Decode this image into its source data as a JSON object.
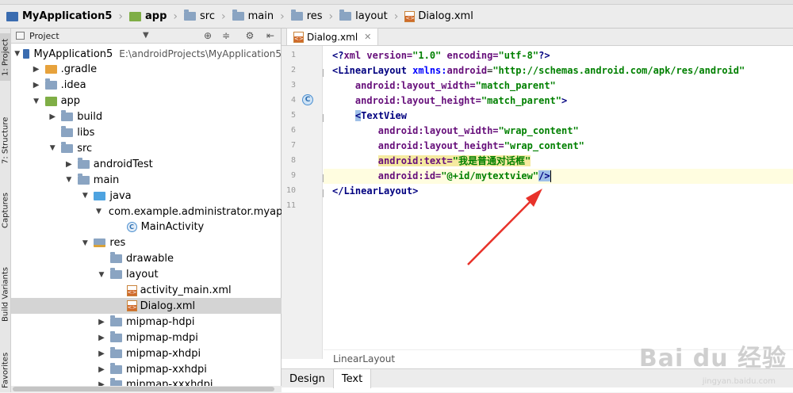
{
  "breadcrumb": [
    {
      "label": "MyApplication5",
      "icon": "project-icon"
    },
    {
      "label": "app",
      "icon": "module-icon"
    },
    {
      "label": "src",
      "icon": "folder-icon"
    },
    {
      "label": "main",
      "icon": "folder-icon"
    },
    {
      "label": "res",
      "icon": "folder-icon"
    },
    {
      "label": "layout",
      "icon": "folder-icon"
    },
    {
      "label": "Dialog.xml",
      "icon": "xml-file-icon"
    }
  ],
  "side_tabs": [
    "1: Project",
    "7: Structure",
    "Captures",
    "Build Variants",
    "Favorites"
  ],
  "project_panel": {
    "title": "Project",
    "tree": [
      {
        "label": "MyApplication5",
        "path": "E:\\androidProjects\\MyApplication5",
        "depth": 0,
        "arrow": "open",
        "icon": "project"
      },
      {
        "label": ".gradle",
        "depth": 1,
        "arrow": "closed",
        "icon": "gradle"
      },
      {
        "label": ".idea",
        "depth": 1,
        "arrow": "closed",
        "icon": "folder"
      },
      {
        "label": "app",
        "depth": 1,
        "arrow": "open",
        "icon": "module"
      },
      {
        "label": "build",
        "depth": 2,
        "arrow": "closed",
        "icon": "folder"
      },
      {
        "label": "libs",
        "depth": 2,
        "arrow": "none",
        "icon": "folder"
      },
      {
        "label": "src",
        "depth": 2,
        "arrow": "open",
        "icon": "folder"
      },
      {
        "label": "androidTest",
        "depth": 3,
        "arrow": "closed",
        "icon": "folder"
      },
      {
        "label": "main",
        "depth": 3,
        "arrow": "open",
        "icon": "folder"
      },
      {
        "label": "java",
        "depth": 4,
        "arrow": "open",
        "icon": "java"
      },
      {
        "label": "com.example.administrator.myappl",
        "depth": 5,
        "arrow": "open",
        "icon": "package"
      },
      {
        "label": "MainActivity",
        "depth": 6,
        "arrow": "none",
        "icon": "class"
      },
      {
        "label": "res",
        "depth": 4,
        "arrow": "open",
        "icon": "res"
      },
      {
        "label": "drawable",
        "depth": 5,
        "arrow": "none",
        "icon": "folder"
      },
      {
        "label": "layout",
        "depth": 5,
        "arrow": "open",
        "icon": "folder"
      },
      {
        "label": "activity_main.xml",
        "depth": 6,
        "arrow": "none",
        "icon": "xml"
      },
      {
        "label": "Dialog.xml",
        "depth": 6,
        "arrow": "none",
        "icon": "xml",
        "selected": true
      },
      {
        "label": "mipmap-hdpi",
        "depth": 5,
        "arrow": "closed",
        "icon": "folder"
      },
      {
        "label": "mipmap-mdpi",
        "depth": 5,
        "arrow": "closed",
        "icon": "folder"
      },
      {
        "label": "mipmap-xhdpi",
        "depth": 5,
        "arrow": "closed",
        "icon": "folder"
      },
      {
        "label": "mipmap-xxhdpi",
        "depth": 5,
        "arrow": "closed",
        "icon": "folder"
      },
      {
        "label": "mipmap-xxxhdpi",
        "depth": 5,
        "arrow": "closed",
        "icon": "folder"
      }
    ]
  },
  "editor": {
    "tab_label": "Dialog.xml",
    "line_numbers": [
      "1",
      "2",
      "3",
      "4",
      "5",
      "6",
      "7",
      "8",
      "9",
      "10",
      "11"
    ],
    "lines": [
      [
        {
          "t": "<?",
          "c": "t-tag"
        },
        {
          "t": "xml ",
          "c": "t-attr"
        },
        {
          "t": "version=",
          "c": "t-attr"
        },
        {
          "t": "\"1.0\"",
          "c": "t-val"
        },
        {
          "t": " encoding=",
          "c": "t-attr"
        },
        {
          "t": "\"utf-8\"",
          "c": "t-val"
        },
        {
          "t": "?>",
          "c": "t-tag"
        }
      ],
      [
        {
          "t": "<LinearLayout ",
          "c": "t-tag"
        },
        {
          "t": "xmlns:",
          "c": "t-ns"
        },
        {
          "t": "android",
          "c": "t-attr"
        },
        {
          "t": "=",
          "c": "t-pl"
        },
        {
          "t": "\"http://schemas.android.com/apk/res/android\"",
          "c": "t-val"
        }
      ],
      [
        {
          "t": "    "
        },
        {
          "t": "android",
          "c": "t-attr"
        },
        {
          "t": ":layout_width=",
          "c": "t-attr"
        },
        {
          "t": "\"match_parent\"",
          "c": "t-val"
        }
      ],
      [
        {
          "t": "    "
        },
        {
          "t": "android",
          "c": "t-attr"
        },
        {
          "t": ":layout_height=",
          "c": "t-attr"
        },
        {
          "t": "\"match_parent\"",
          "c": "t-val"
        },
        {
          "t": ">",
          "c": "t-tag"
        }
      ],
      [
        {
          "t": "    "
        },
        {
          "t": "<",
          "c": "t-tag hl-brace"
        },
        {
          "t": "TextView",
          "c": "t-tag"
        }
      ],
      [
        {
          "t": "        "
        },
        {
          "t": "android",
          "c": "t-attr"
        },
        {
          "t": ":layout_width=",
          "c": "t-attr"
        },
        {
          "t": "\"wrap_content\"",
          "c": "t-val"
        }
      ],
      [
        {
          "t": "        "
        },
        {
          "t": "android",
          "c": "t-attr"
        },
        {
          "t": ":layout_height=",
          "c": "t-attr"
        },
        {
          "t": "\"wrap_content\"",
          "c": "t-val"
        }
      ],
      [
        {
          "t": "        "
        },
        {
          "t": "android:text=",
          "c": "t-attr hl-text"
        },
        {
          "t": "\"我是普通对话框\"",
          "c": "t-val hl-text"
        }
      ],
      [
        {
          "t": "        "
        },
        {
          "t": "android",
          "c": "t-attr"
        },
        {
          "t": ":id=",
          "c": "t-attr"
        },
        {
          "t": "\"@+id/mytextview\"",
          "c": "t-val"
        },
        {
          "t": "/>",
          "c": "t-tag hl-brace"
        }
      ],
      [
        {
          "t": "</LinearLayout>",
          "c": "t-tag"
        }
      ],
      []
    ],
    "structure_breadcrumb": "LinearLayout",
    "bottom_tabs": [
      "Design",
      "Text"
    ],
    "active_bottom_tab": "Text"
  },
  "watermark": {
    "main": "Bai du 经验",
    "sub": "jingyan.baidu.com"
  },
  "colors": {
    "tag": "#000080",
    "attr": "#660e7a",
    "value": "#008000",
    "arrow": "#e8322a",
    "selected_row": "#d4d4d4"
  }
}
